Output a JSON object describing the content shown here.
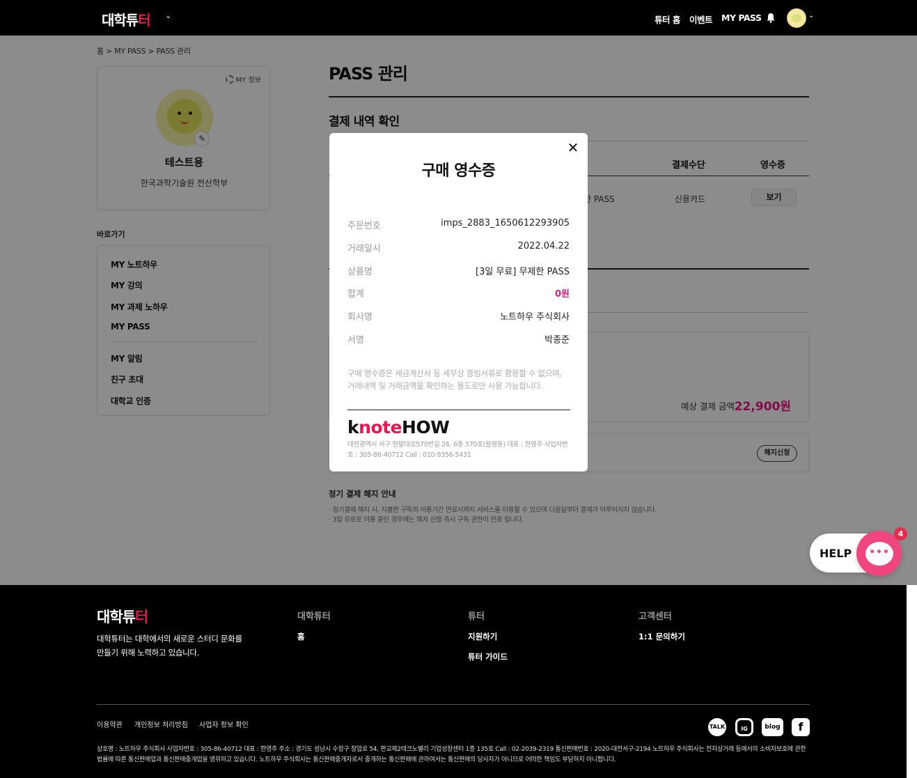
{
  "header": {
    "logo_main": "대학튜",
    "logo_accent": "터",
    "nav": [
      "튜터 홈",
      "이벤트",
      "MY PASS"
    ],
    "icons": [
      "bell-icon",
      "avatar",
      "chevron-down-icon"
    ]
  },
  "breadcrumb": "홈 > MY PASS > PASS 관리",
  "profile": {
    "my_info_label": "MY 정보",
    "name": "테스트용",
    "school": "한국과학기술원 전산학부"
  },
  "shortcuts": {
    "label": "바로가기",
    "group1": [
      "MY 노트하우",
      "MY 강의",
      "MY 과제 노하우",
      "MY PASS"
    ],
    "group2": [
      "MY 알림",
      "친구 초대",
      "대학교 인증"
    ]
  },
  "main": {
    "title": "PASS 관리",
    "section_title": "결제 내역 확인",
    "columns": {
      "method": "결제수단",
      "receipt": "영수증"
    },
    "row": {
      "product_partial": "한 PASS",
      "method": "신용카드",
      "receipt_button": "보기"
    },
    "estimate_label": "예상 결제 금액",
    "estimate_amount": "22,900원",
    "cancel_button": "해지신청",
    "notice_title": "정기 결제 해지 안내",
    "notice_lines": [
      "· 정기결제 해지 시, 지불한 구독의 이용기간 만료시까지 서비스를 이용할 수 있으며 다음달부터 결제가 이루어지지 않습니다.",
      "· 3일 무료로 이용 중인 경우에는 해지 신청 즉시 구독 권한이 만료 됩니다."
    ]
  },
  "modal": {
    "title": "구매 영수증",
    "close_icon": "close-icon",
    "rows": [
      {
        "label": "주문번호",
        "value": "imps_2883_1650612293905"
      },
      {
        "label": "거래일시",
        "value": "2022.04.22"
      },
      {
        "label": "상품명",
        "value": "[3일 무료] 무제한 PASS"
      },
      {
        "label": "합계",
        "value": "0원"
      },
      {
        "label": "회사명",
        "value": "노트하우 주식회사"
      },
      {
        "label": "서명",
        "value": "박종준"
      }
    ],
    "note": "구매 영수증은 세금계산서 등 세무상 증빙서류로 활용할 수 없으며, 거래내역 및 거래금액을 확인하는 용도로만 사용 가능합니다.",
    "logo_prefix": "k",
    "logo_accent": "note",
    "logo_suffix": "HOW",
    "address": "대전광역시 서구 한밭대로570번길 26, 6층 570호(월평동) 대표 : 한영주 사업자번호 : 305-86-40712 Call : 010-9356-5431"
  },
  "help": {
    "label": "HELP",
    "badge": "4"
  },
  "footer": {
    "logo_main": "대학튜",
    "logo_accent": "터",
    "desc1": "대학튜터는 대학에서의 새로운 스터디 문화를",
    "desc2": "만들기 위해 노력하고 있습니다.",
    "col1_title": "대학튜터",
    "col1_links": [
      "홈"
    ],
    "col2_title": "튜터",
    "col2_links": [
      "지원하기",
      "튜터 가이드"
    ],
    "col3_title": "고객센터",
    "col3_links": [
      "1:1 문의하기"
    ],
    "bottom_links": [
      "이용약관",
      "개인정보 처리방침",
      "사업자 정보 확인"
    ],
    "sns": [
      "TALK",
      "IG",
      "blog",
      "f"
    ],
    "legal": "상호명 : 노트하우 주식회사 사업자번호 : 305-86-40712 대표 : 한영주 주소 : 경기도 성남시 수정구 창업로 54, 판교제2테크노밸리 기업성장센터 1층 135호 Call : 02-2039-2319 통신판매번호 : 2020-대전서구-2194 노트하우 주식회사는 전자상거래 등에서의 소비자보호에 관한 법률에 따른 통신판매업과 통신판매중개업을 영위하고 있습니다. 노트하우 주식회사는 통신판매중개자로서 중개하는 통신판매에 관하여서는 통신판매의 당사자가 아니므로 어떠한 책임도 부담하지 아니합니다."
  }
}
